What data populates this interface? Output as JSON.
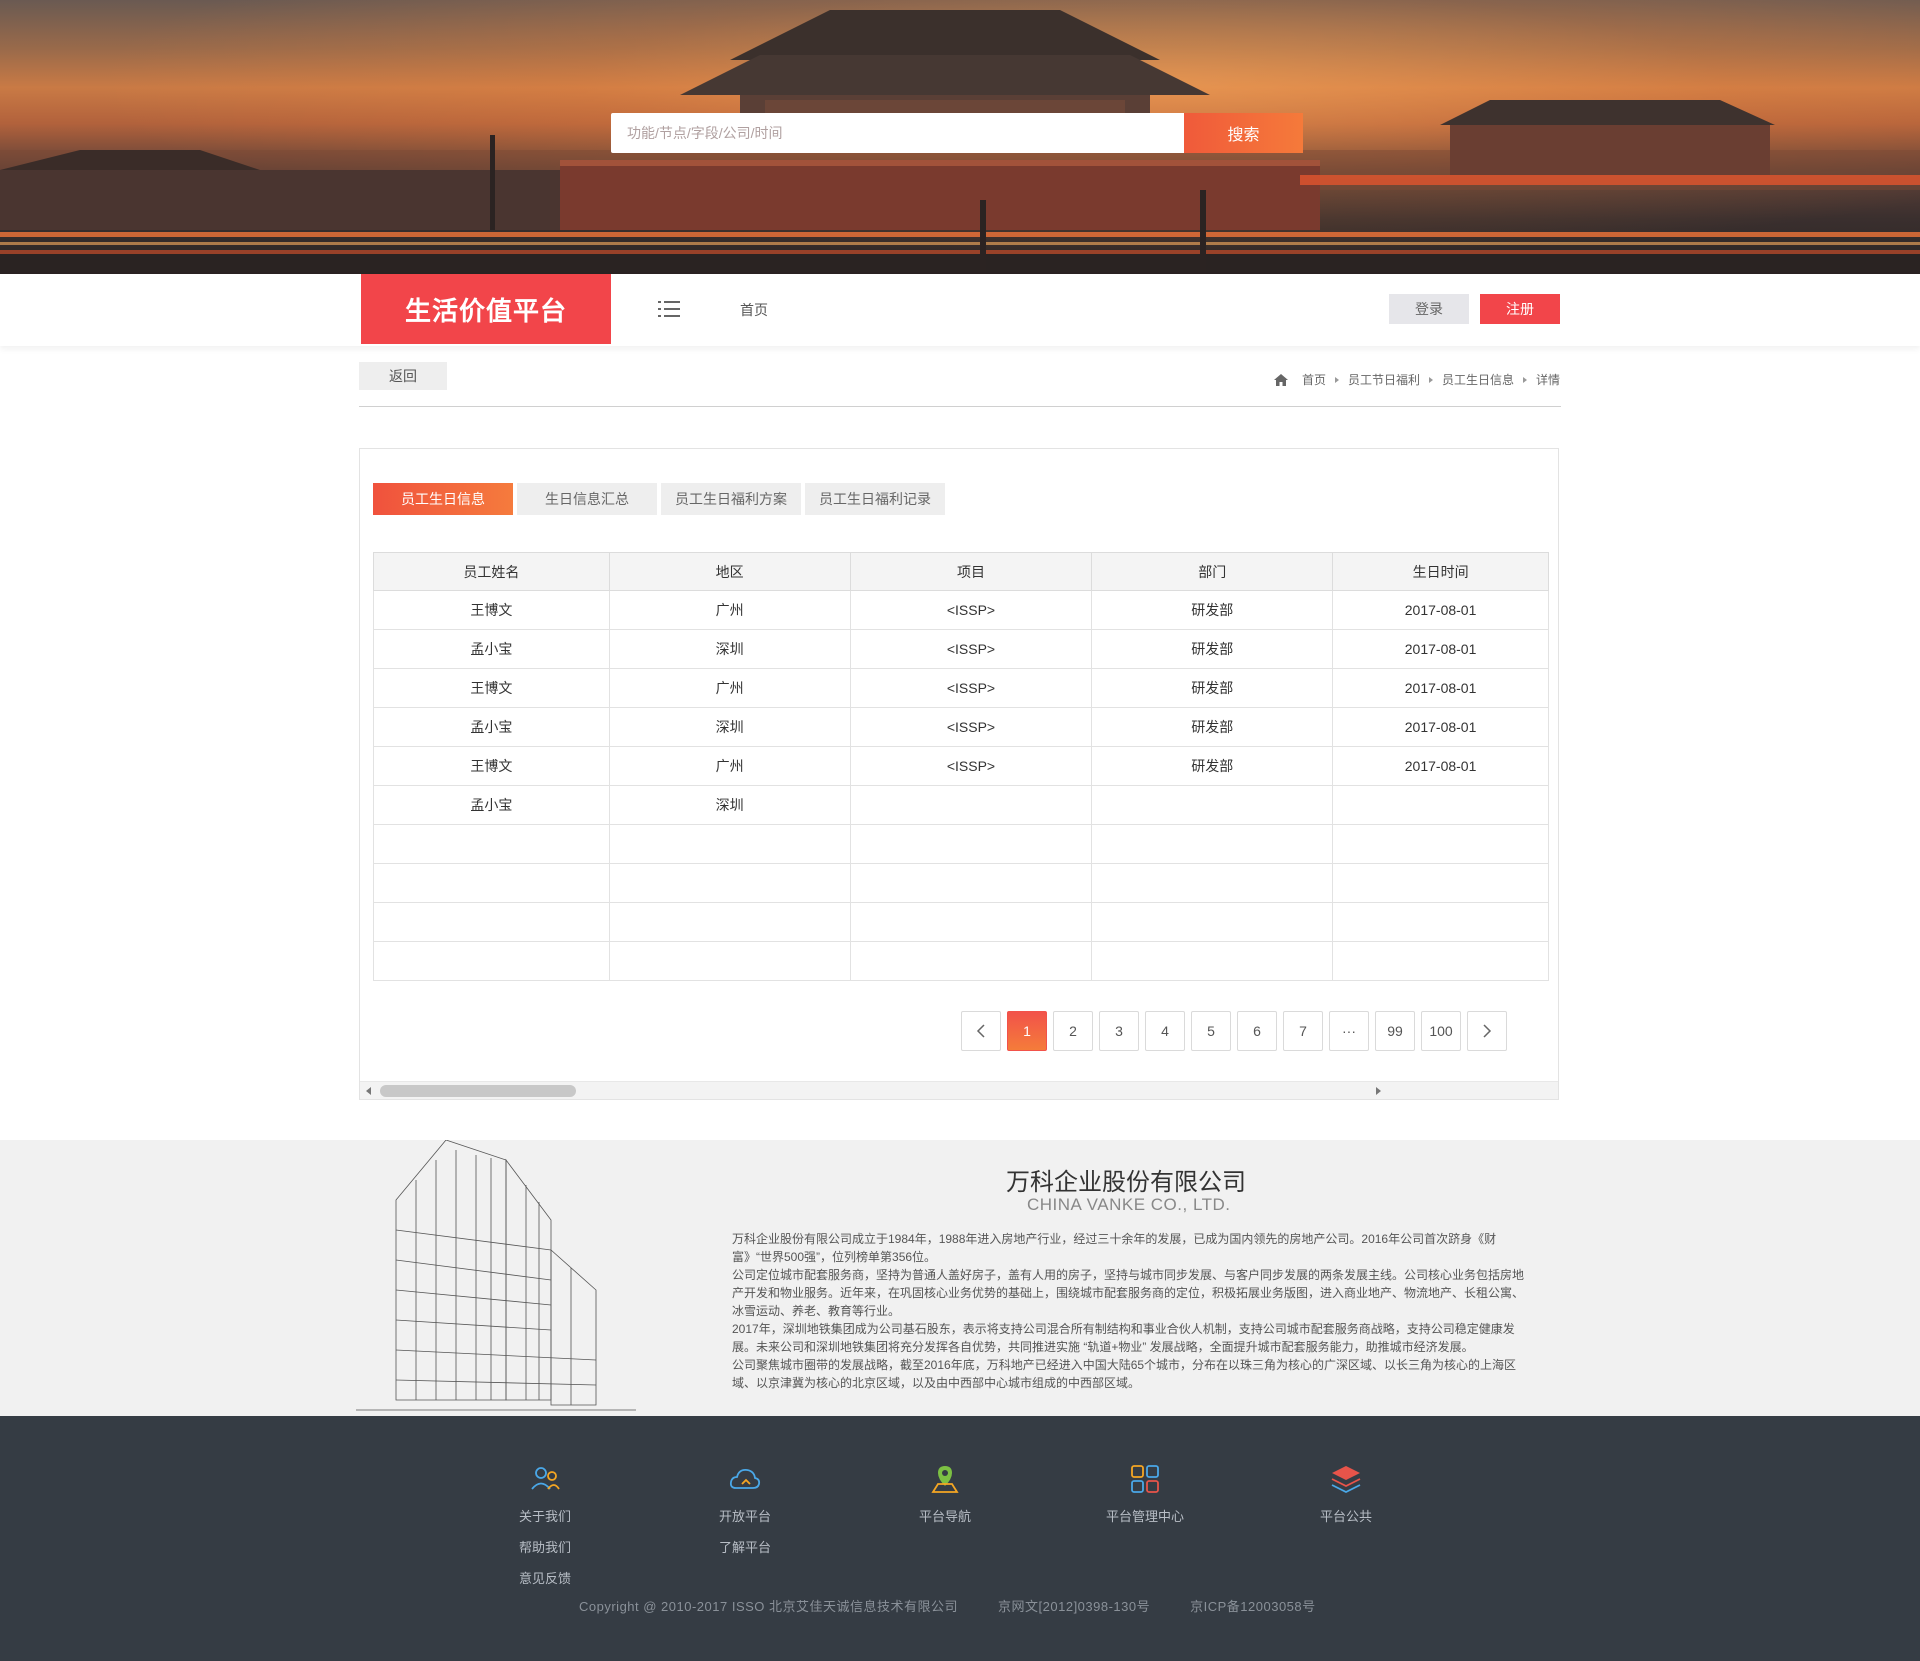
{
  "search": {
    "placeholder": "功能/节点/字段/公司/时间",
    "button": "搜索"
  },
  "nav": {
    "brand": "生活价值平台",
    "home": "首页",
    "login": "登录",
    "register": "注册"
  },
  "toolbar": {
    "back": "返回"
  },
  "breadcrumb": [
    "首页",
    "员工节日福利",
    "员工生日信息",
    "详情"
  ],
  "tabs": [
    "员工生日信息",
    "生日信息汇总",
    "员工生日福利方案",
    "员工生日福利记录"
  ],
  "table": {
    "headers": [
      "员工姓名",
      "地区",
      "项目",
      "部门",
      "生日时间"
    ],
    "rows": [
      [
        "王博文",
        "广州",
        "<ISSP>",
        "研发部",
        "2017-08-01"
      ],
      [
        "孟小宝",
        "深圳",
        "<ISSP>",
        "研发部",
        "2017-08-01"
      ],
      [
        "王博文",
        "广州",
        "<ISSP>",
        "研发部",
        "2017-08-01"
      ],
      [
        "孟小宝",
        "深圳",
        "<ISSP>",
        "研发部",
        "2017-08-01"
      ],
      [
        "王博文",
        "广州",
        "<ISSP>",
        "研发部",
        "2017-08-01"
      ],
      [
        "孟小宝",
        "深圳",
        "",
        "",
        ""
      ],
      [
        "",
        "",
        "",
        "",
        ""
      ],
      [
        "",
        "",
        "",
        "",
        ""
      ],
      [
        "",
        "",
        "",
        "",
        ""
      ],
      [
        "",
        "",
        "",
        "",
        ""
      ]
    ]
  },
  "pagination": {
    "current": "1",
    "pages": [
      "1",
      "2",
      "3",
      "4",
      "5",
      "6",
      "7",
      "···",
      "99",
      "100"
    ]
  },
  "company": {
    "name": "万科企业股份有限公司",
    "name_en": "CHINA VANKE CO., LTD.",
    "paragraphs": [
      "万科企业股份有限公司成立于1984年，1988年进入房地产行业，经过三十余年的发展，已成为国内领先的房地产公司。2016年公司首次跻身《财富》“世界500强”，位列榜单第356位。",
      "公司定位城市配套服务商，坚持为普通人盖好房子，盖有人用的房子，坚持与城市同步发展、与客户同步发展的两条发展主线。公司核心业务包括房地产开发和物业服务。近年来，在巩固核心业务优势的基础上，围绕城市配套服务商的定位，积极拓展业务版图，进入商业地产、物流地产、长租公寓、冰雪运动、养老、教育等行业。",
      "2017年，深圳地铁集团成为公司基石股东，表示将支持公司混合所有制结构和事业合伙人机制，支持公司城市配套服务商战略，支持公司稳定健康发展。未来公司和深圳地铁集团将充分发挥各自优势，共同推进实施 “轨道+物业” 发展战略，全面提升城市配套服务能力，助推城市经济发展。",
      "公司聚焦城市圈带的发展战略，截至2016年底，万科地产已经进入中国大陆65个城市，分布在以珠三角为核心的广深区域、以长三角为核心的上海区域、以京津冀为核心的北京区域，以及由中西部中心城市组成的中西部区域。"
    ]
  },
  "footer": {
    "columns": [
      {
        "icon": "users-icon",
        "links": [
          "关于我们",
          "帮助我们",
          "意见反馈"
        ]
      },
      {
        "icon": "cloud-icon",
        "links": [
          "开放平台",
          "了解平台"
        ]
      },
      {
        "icon": "map-pin-icon",
        "links": [
          "平台导航"
        ]
      },
      {
        "icon": "grid-icon",
        "links": [
          "平台管理中心"
        ]
      },
      {
        "icon": "layers-icon",
        "links": [
          "平台公共"
        ]
      }
    ],
    "copyright": "Copyright @ 2010-2017 ISSO 北京艾佳天诚信息技术有限公司",
    "license": "京网文[2012]0398-130号",
    "icp": "京ICP备12003058号"
  },
  "colors": {
    "brand": "#f2454a",
    "accent": "#f57b3d",
    "footer_bg": "#353c44",
    "company_bg": "#f1f1f1"
  }
}
